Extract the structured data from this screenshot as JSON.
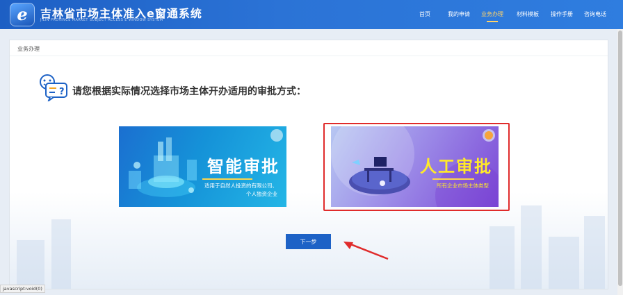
{
  "header": {
    "logo_glyph": "e",
    "logo_title": "吉林省市场主体准入e窗通系统",
    "logo_subtitle": "JILIN PROVINCE MARKET SUBJECT ACCESS E WINDOW SYSTEM",
    "nav": [
      {
        "label": "首页"
      },
      {
        "label": "我的申请"
      },
      {
        "label": "业务办理"
      },
      {
        "label": "材料模板"
      },
      {
        "label": "操作手册"
      },
      {
        "label": "咨询电话"
      }
    ],
    "active_nav": "业务办理"
  },
  "breadcrumb": "业务办理",
  "question": "请您根据实际情况选择市场主体开办适用的审批方式：",
  "cards": {
    "smart": {
      "title": "智能审批",
      "desc_line1": "适用于自然人投资的有限公司、",
      "desc_line2": "个人独资企业"
    },
    "manual": {
      "title": "人工审批",
      "desc": "所有企业市场主体类型",
      "selected": true
    }
  },
  "next_button": "下一步",
  "status_bar": "javascript:void(0)",
  "colors": {
    "header_blue": "#2b73d6",
    "active_nav": "#ffd36a",
    "button_blue": "#1d62c6",
    "selection_red": "#e02b2b",
    "manual_title": "#ffe92a"
  }
}
